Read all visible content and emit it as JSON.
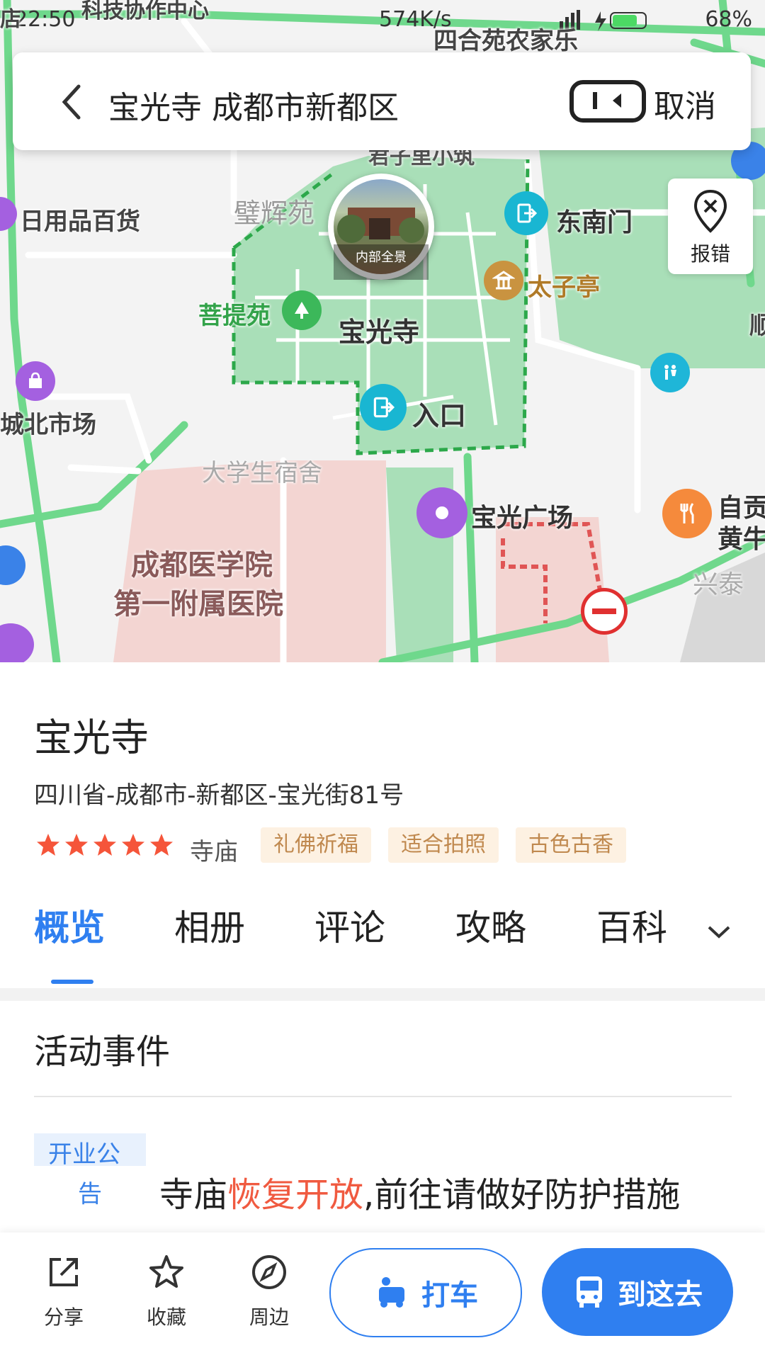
{
  "status_bar": {
    "time": "22:50",
    "speed": "574K/s",
    "battery": "68%"
  },
  "search": {
    "query": "宝光寺 成都市新都区",
    "cancel_label": "取消"
  },
  "report_button": {
    "label": "报错"
  },
  "map": {
    "labels": {
      "top_center": "科技协作中心",
      "farm": "四合苑农家乐",
      "school": "君子里小筑",
      "bihui": "璧辉苑",
      "daily": "日用品百货",
      "southeast_gate": "东南门",
      "taizi": "太子亭",
      "puti": "菩提苑",
      "temple": "宝光寺",
      "entrance": "入口",
      "north_market": "城北市场",
      "dorm": "大学生宿舍",
      "square": "宝光广场",
      "hospital_line1": "成都医学院",
      "hospital_line2": "第一附属医院",
      "food_line1": "自贡",
      "food_line2": "黄牛",
      "xingtai": "兴泰",
      "shun": "顺",
      "shop_left": "店",
      "pano_caption": "内部全景"
    }
  },
  "place": {
    "name": "宝光寺",
    "address": "四川省-成都市-新都区-宝光街81号",
    "rating": 5,
    "category": "寺庙",
    "tags": [
      "礼佛祈福",
      "适合拍照",
      "古色古香"
    ]
  },
  "tabs": [
    "概览",
    "相册",
    "评论",
    "攻略",
    "百科"
  ],
  "events": {
    "title": "活动事件",
    "badge_line1": "开业公",
    "badge_line2": "告",
    "text_before": "寺庙",
    "text_highlight": "恢复开放",
    "text_after": ",前往请做好防护措施"
  },
  "bottom_bar": {
    "share": "分享",
    "favorite": "收藏",
    "nearby": "周边",
    "taxi": "打车",
    "go": "到这去"
  },
  "colors": {
    "accent": "#2f7ff0",
    "highlight": "#f05a40",
    "star": "#f5553a",
    "road": "#6fd88c",
    "park": "#a9dfb8"
  }
}
